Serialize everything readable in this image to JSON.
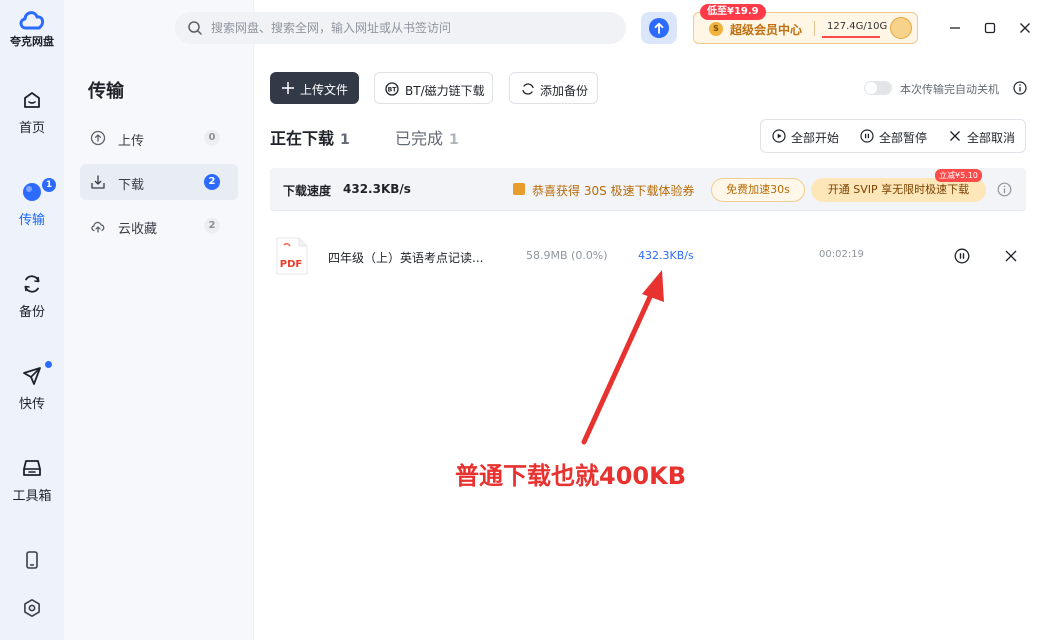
{
  "app": {
    "name": "夸克网盘"
  },
  "rail": {
    "items": [
      {
        "label": "首页",
        "icon": "home-icon"
      },
      {
        "label": "传输",
        "icon": "transfer-icon",
        "badge": "1",
        "active": true
      },
      {
        "label": "备份",
        "icon": "backup-icon"
      },
      {
        "label": "快传",
        "icon": "send-icon"
      },
      {
        "label": "工具箱",
        "icon": "toolbox-icon"
      }
    ],
    "bottom_icons": [
      "phone-icon",
      "settings-icon"
    ]
  },
  "sidebar": {
    "title": "传输",
    "items": [
      {
        "label": "上传",
        "count": "0"
      },
      {
        "label": "下载",
        "count": "2",
        "active": true
      },
      {
        "label": "云收藏",
        "count": "2"
      }
    ]
  },
  "header": {
    "search_placeholder": "搜索网盘、搜索全网，输入网址或从书签访问",
    "vip_tag": "低至¥19.9",
    "vip_coin": "S",
    "vip_label": "超级会员中心",
    "storage": "127.4G/10G"
  },
  "toolbar": {
    "upload_label": "上传文件",
    "magnet_label": "BT/磁力链下载",
    "backup_label": "添加备份",
    "auto_shutdown_label": "本次传输完自动关机"
  },
  "tabs": [
    {
      "label": "正在下载",
      "count": "1",
      "active": true
    },
    {
      "label": "已完成",
      "count": "1"
    }
  ],
  "bulk_actions": {
    "start_all": "全部开始",
    "pause_all": "全部暂停",
    "cancel_all": "全部取消"
  },
  "speed_bar": {
    "label": "下载速度",
    "value": "432.3KB/s",
    "gift_text": "恭喜获得 30S 极速下载体验券",
    "free_boost": "免费加速30s",
    "svip_offer": "开通 SVIP 享无限时极速下载",
    "svip_discount": "立减¥5.10"
  },
  "downloads": [
    {
      "file_type": "PDF",
      "name": "四年级（上）英语考点记读...",
      "size": "58.9MB (0.0%)",
      "speed": "432.3KB/s",
      "time": "00:02:19"
    }
  ],
  "annotation": {
    "text": "普通下载也就400KB",
    "color": "#e8322f"
  },
  "colors": {
    "accent": "#2d6bff",
    "annotation": "#e8322f",
    "vip_gold": "#c07010"
  }
}
